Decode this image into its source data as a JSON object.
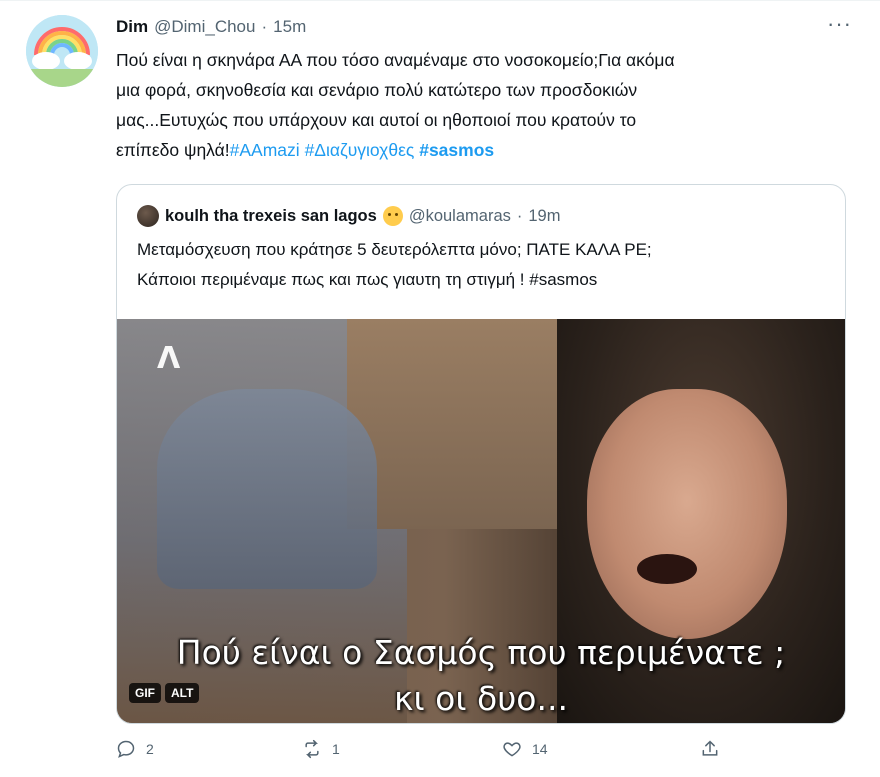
{
  "tweet": {
    "author_name": "Dim",
    "author_handle": "@Dimi_Chou",
    "separator": "·",
    "time": "15m",
    "more_label": "···",
    "text_line1": "Πού είναι η σκηνάρα ΑΑ που τόσο αναμέναμε στο νοσοκομείο;Για ακόμα",
    "text_line2": "μια φορά, σκηνοθεσία και σενάριο πολύ κατώτερο των προσδοκιών",
    "text_line3": "μας...Ευτυχώς που υπάρχουν και αυτοί οι ηθοποιοί που κρατούν το",
    "text_line4_prefix": "επίπεδο ψηλά!",
    "hashtags": [
      "#AAmazi",
      "#Διαζυγιοχθες",
      "#sasmos"
    ],
    "replies": "2",
    "retweets": "1",
    "likes": "14"
  },
  "quote": {
    "author_name": "koulh tha trexeis san lagos",
    "author_handle": "@koulamaras",
    "separator": "·",
    "time": "19m",
    "text_line1": "Μεταμόσχευση που κράτησε 5 δευτερόλεπτα μόνο; ΠΑΤΕ ΚΑΛΑ ΡΕ;",
    "text_line2": "Κάποιοι περιμέναμε πως και πως γιαυτη τη στιγμή ! #sasmos",
    "media": {
      "caption_line1": "Πού είναι ο Σασμός που περιμένατε ;",
      "caption_line2": "κι οι δυο...",
      "channel_logo": "Λ",
      "badge_gif": "GIF",
      "badge_alt": "ALT"
    }
  },
  "colors": {
    "link": "#1d9bf0",
    "secondary": "#536471",
    "border": "#cfd9de"
  }
}
